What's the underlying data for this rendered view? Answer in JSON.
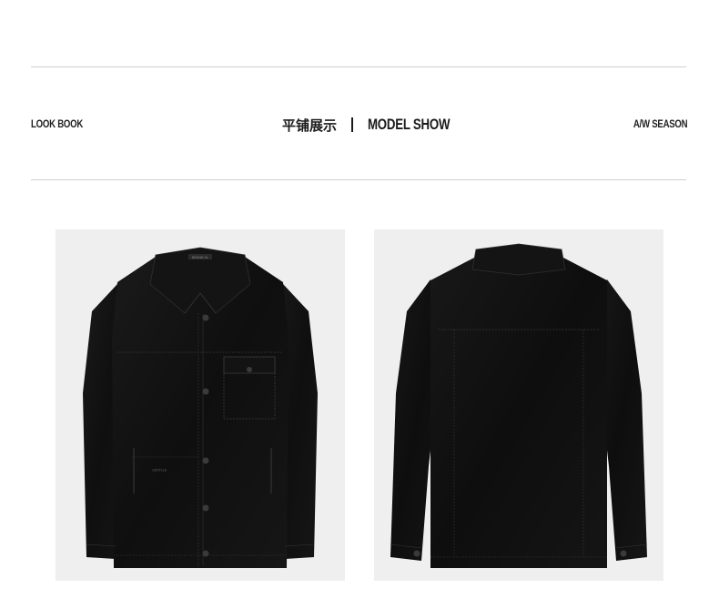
{
  "header": {
    "left_label": "LOOK BOOK",
    "title_cn": "平铺展示",
    "separator": "|",
    "title_en": "MODEL SHOW",
    "right_label": "A/W SEASON"
  },
  "products": [
    {
      "view": "front",
      "image": "jacket-front",
      "neck_label": "MOMA XL",
      "pocket_print": "VIRTUS"
    },
    {
      "view": "back",
      "image": "jacket-back"
    }
  ],
  "colors": {
    "background": "#ffffff",
    "panel": "#efefef",
    "jacket": "#111111",
    "stitch": "#3a3a3a",
    "rule": "#cfcfcf",
    "text": "#1a1a1a"
  }
}
